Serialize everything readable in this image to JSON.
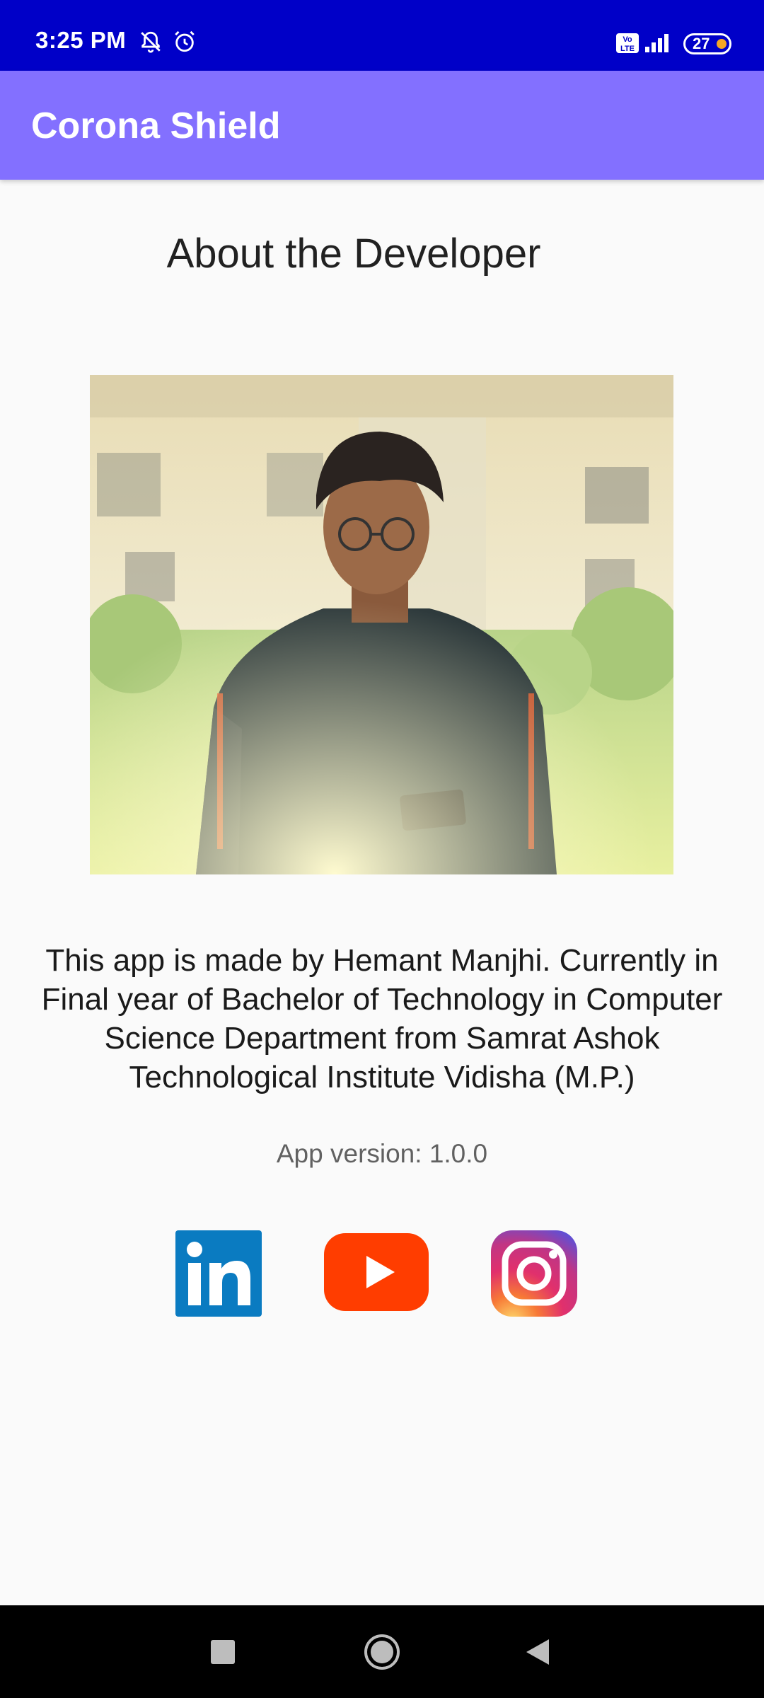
{
  "status_bar": {
    "time": "3:25 PM",
    "icons": [
      "bell-off-icon",
      "alarm-icon",
      "volte-icon",
      "signal-icon",
      "battery-icon"
    ],
    "battery_level": "27"
  },
  "app_bar": {
    "title": "Corona Shield",
    "color": "#8370ff"
  },
  "content": {
    "heading": "About the Developer",
    "description": "This app is made by Hemant Manjhi. Currently in Final year of Bachelor of Technology in Computer Science Department from Samrat Ashok Technological Institute Vidisha (M.P.)",
    "version": "App version: 1.0.0"
  },
  "social_links": [
    {
      "name": "linkedin-icon",
      "label": "in",
      "color": "#0a7bc1"
    },
    {
      "name": "youtube-icon",
      "color": "#ff3d00"
    },
    {
      "name": "instagram-icon",
      "color": "#c13584"
    }
  ],
  "nav_bar": {
    "buttons": [
      "recents-button",
      "home-button",
      "back-button"
    ]
  }
}
